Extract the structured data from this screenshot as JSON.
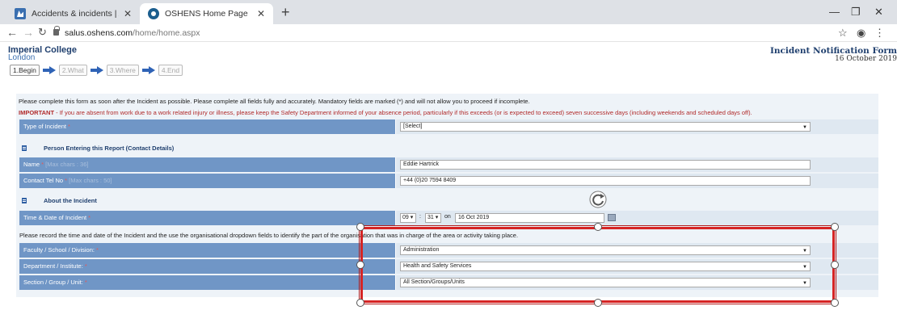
{
  "browser": {
    "tabs": [
      {
        "title": "Accidents & incidents | Administ",
        "active": false
      },
      {
        "title": "OSHENS Home Page",
        "active": true
      }
    ],
    "url_host": "salus.oshens.com",
    "url_path": "/home/home.aspx"
  },
  "header": {
    "logo_line1": "Imperial College",
    "logo_line2": "London",
    "form_title": "Incident Notification Form",
    "form_date": "16 October 2019"
  },
  "steps": [
    "1.Begin",
    "2.What",
    "3.Where",
    "4.End"
  ],
  "notes": {
    "intro": "Please complete this form as soon after the Incident as possible. Please complete all fields fully and accurately. Mandatory fields are marked (*) and will not allow you to proceed if incomplete.",
    "important_label": "IMPORTANT",
    "important_text": " - If you are absent from work due to a work related injury or illness, please keep the Safety Department informed of your absence period, particularly if this exceeds (or is expected to exceed) seven successive days (including weekends and scheduled days off).",
    "instruction": "Please record the time and date of the Incident and the use the organisational dropdown fields to identify the part of the organisation that was in charge of the area or activity taking place."
  },
  "fields": {
    "type_of_incident": {
      "label": "Type of Incident",
      "req": " *",
      "value": "[Select]"
    },
    "contact_section": "Person Entering this Report (Contact Details)",
    "name": {
      "label": "Name",
      "req": " *",
      "hint": " [Max chars : 36]",
      "value": "Eddie Hartrick"
    },
    "tel": {
      "label": "Contact Tel No",
      "req": " *",
      "hint": " [Max chars : 50]",
      "value": "+44 (0)20 7594 8409"
    },
    "about_section": "About the Incident",
    "time_date": {
      "label": "Time & Date of Incident",
      "req": " *",
      "hour": "09",
      "minute": "31",
      "colon": ":",
      "on": "on",
      "date": "16 Oct 2019"
    },
    "faculty": {
      "label": "Faculty / School / Division:",
      "req": " *",
      "value": "Administration"
    },
    "department": {
      "label": "Department / Institute:",
      "req": " *",
      "value": "Health and Safety Services"
    },
    "section": {
      "label": "Section / Group / Unit:",
      "req": " *",
      "value": "All Section/Groups/Units"
    }
  },
  "colors": {
    "label_bg": "#7096c6",
    "value_bg": "#dfe8f1",
    "selection": "#d62424",
    "important": "#b12a2a"
  }
}
